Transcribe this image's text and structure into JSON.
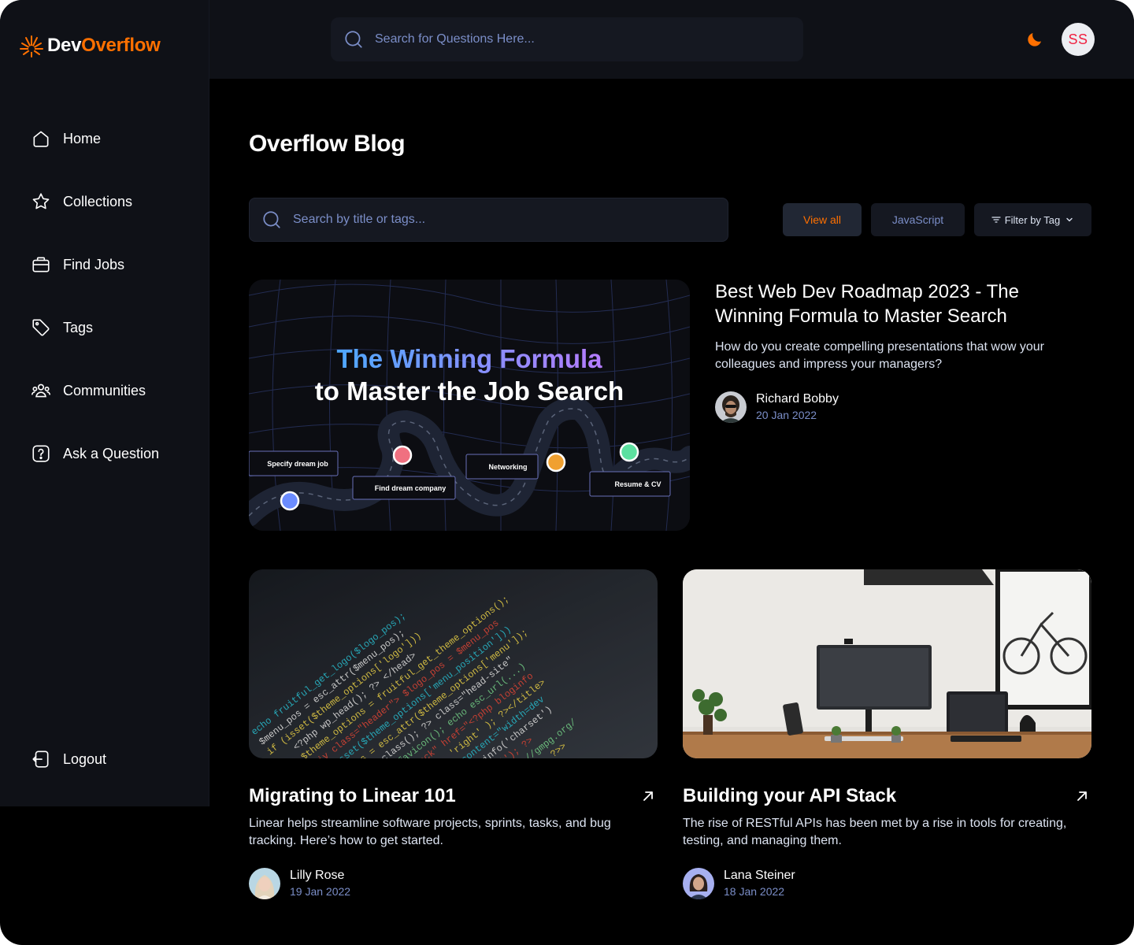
{
  "app": {
    "logo_prefix": "Dev",
    "logo_accent": "Overflow"
  },
  "header": {
    "search_placeholder": "Search for Questions Here...",
    "avatar_initials": "SS"
  },
  "sidebar": {
    "items": [
      {
        "label": "Home",
        "icon": "home-icon"
      },
      {
        "label": "Collections",
        "icon": "star-icon"
      },
      {
        "label": "Find Jobs",
        "icon": "briefcase-icon"
      },
      {
        "label": "Tags",
        "icon": "tag-icon"
      },
      {
        "label": "Communities",
        "icon": "users-icon"
      },
      {
        "label": "Ask a Question",
        "icon": "question-icon"
      }
    ],
    "logout_label": "Logout"
  },
  "main": {
    "title": "Overflow Blog",
    "search_placeholder": "Search by title or tags...",
    "filters": {
      "view_all": "View all",
      "javascript": "JavaScript",
      "filter_by_tag": "Filter by Tag"
    },
    "featured": {
      "title": "Best Web Dev Roadmap 2023 - The Winning Formula to Master Search",
      "description": "How do you create compelling presentations that wow your colleagues and impress your managers?",
      "author": "Richard Bobby",
      "date": "20 Jan 2022",
      "image": {
        "headline_1": "The Winning Formula",
        "headline_2": "to Master the Job Search",
        "step_1": "Specify dream job",
        "step_2": "Find dream company",
        "step_3": "Networking",
        "step_4": "Resume & CV"
      }
    },
    "posts": [
      {
        "title": "Migrating to Linear 101",
        "description": "Linear helps streamline software projects, sprints, tasks, and bug tracking. Here’s how to get started.",
        "author": "Lilly Rose",
        "date": "19 Jan 2022"
      },
      {
        "title": "Building your API Stack",
        "description": "The rise of RESTful APIs has been met by a rise in tools for creating, testing, and managing them.",
        "author": "Lana Steiner",
        "date": "18 Jan 2022"
      }
    ]
  },
  "colors": {
    "accent": "#ff7000",
    "muted_blue": "#7b8ec8",
    "sidebar_bg": "#0f1117",
    "page_bg": "#000000"
  }
}
